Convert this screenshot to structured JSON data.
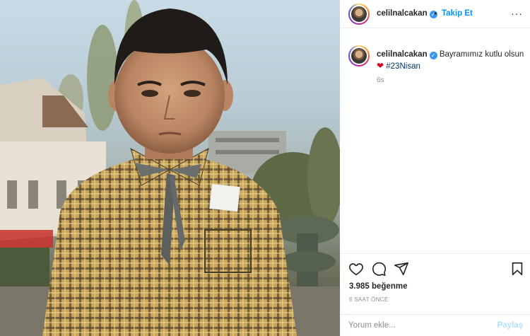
{
  "post": {
    "image_alt": "Vintage photo of a young boy in a yellow checked shirt with a ribbon tie"
  },
  "header": {
    "username": "celilnalcakan",
    "verified_icon": "verified-badge-icon",
    "separator": "•",
    "follow_label": "Takip Et",
    "more_icon": "more-options-icon"
  },
  "caption": {
    "username": "celilnalcakan",
    "text_before": "Bayramımız kutlu olsun",
    "emoji": "❤",
    "hashtag": "#23Nisan",
    "time": "6s"
  },
  "actions": {
    "like_icon": "heart-icon",
    "comment_icon": "comment-icon",
    "share_icon": "paper-plane-icon",
    "save_icon": "bookmark-icon",
    "likes": "3.985 beğenme",
    "posted_ago": "6 SAAT ÖNCE"
  },
  "comment": {
    "placeholder": "Yorum ekle...",
    "share_label": "Paylaş"
  },
  "colors": {
    "accent": "#0095f6",
    "verified": "#3897f0",
    "heart": "#d0021b",
    "hashtag": "#00376b"
  }
}
